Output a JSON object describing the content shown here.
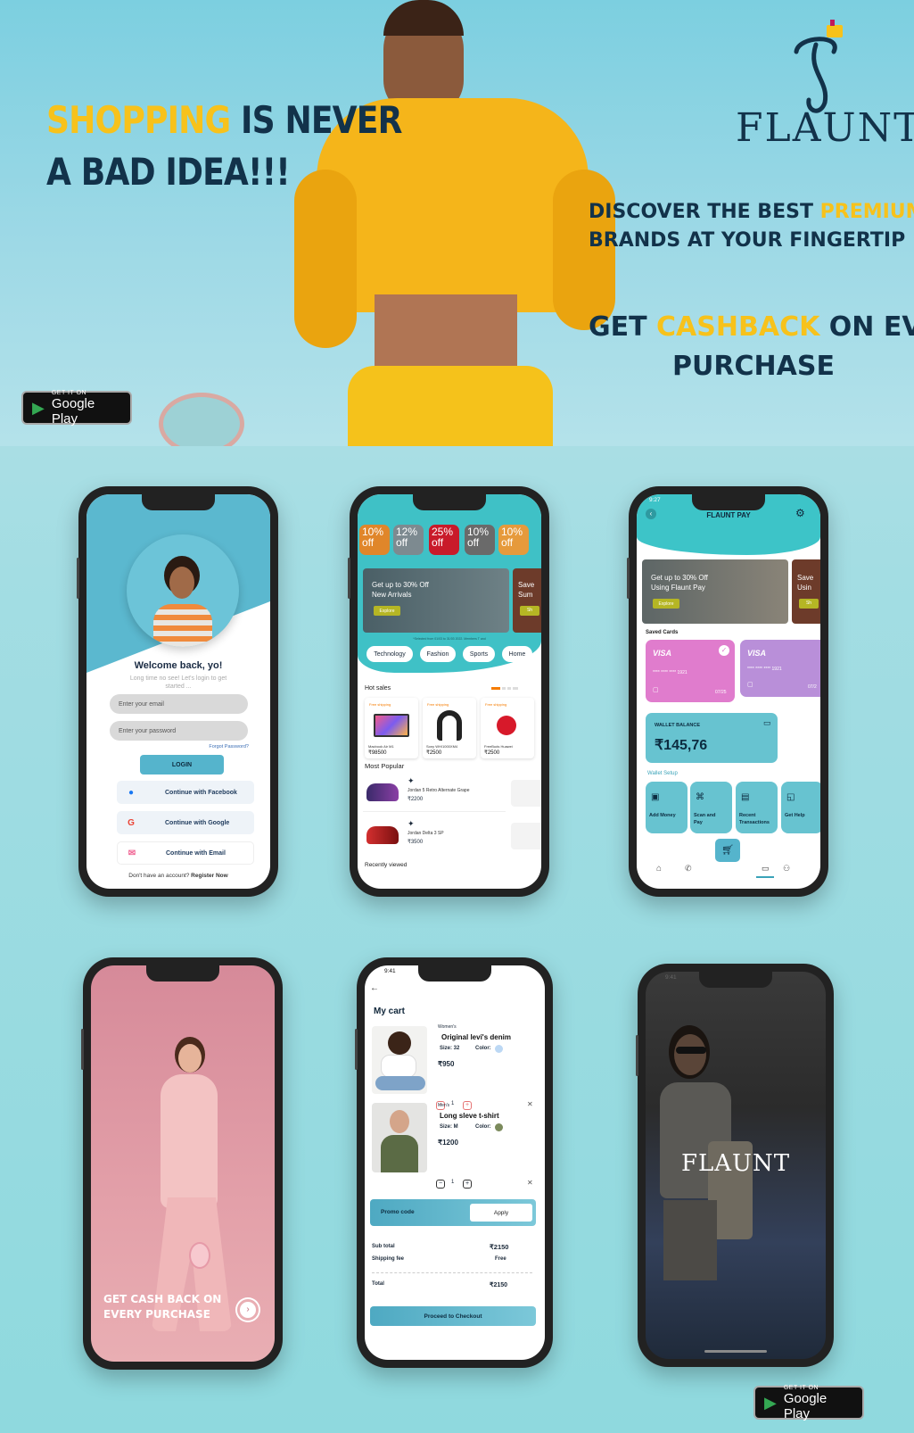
{
  "hero": {
    "headline_yellow": "SHOPPING",
    "headline_rest1": " IS NEVER",
    "headline_line2": "A BAD IDEA!!!",
    "brand": "FLAUNT",
    "tag1_pre": "DISCOVER THE BEST ",
    "tag1_yellow": "PREMIUM",
    "tag1_line2": "BRANDS AT YOUR FINGERTIP",
    "tag2_pre": "GET ",
    "tag2_yellow": "CASHBACK",
    "tag2_post": " ON EVERY",
    "tag2_line2": "PURCHASE",
    "gp_small": "GET IT ON",
    "gp_big": "Google Play"
  },
  "login": {
    "title": "Welcome back, yo!",
    "subtitle1": "Long time no see! Let's login to get",
    "subtitle2": "started ...",
    "email_placeholder": "Enter your email",
    "password_placeholder": "Enter your password",
    "forgot": "Forgot Password?",
    "login_btn": "LOGIN",
    "facebook": "Continue with Facebook",
    "google": "Continue with Google",
    "email": "Continue with Email",
    "no_account": "Don't have an account? ",
    "register": "Register Now"
  },
  "home": {
    "offers": [
      "10% off",
      "12% off",
      "25% off",
      "10% off",
      "10% off"
    ],
    "banner_title1": "Get up to 30% Off",
    "banner_title2": "New Arrivals",
    "banner_btn": "Explore",
    "banner2_a": "Save",
    "banner2_b": "Sum",
    "banner2_btn": "Sh",
    "terms": "*Selected from 01/03 to 31/03 2022. Members T and",
    "categories": [
      "Technology",
      "Fashion",
      "Sports",
      "Home"
    ],
    "hot_sales": "Hot sales",
    "products": [
      {
        "tag": "Free shipping",
        "name": "Macbook Air M1",
        "price": "₹98500"
      },
      {
        "tag": "Free shipping",
        "name": "Sony WH/1000XM4",
        "price": "₹2500"
      },
      {
        "tag": "Free shipping",
        "name": "FreeBuds Huawei",
        "price": "₹2500"
      }
    ],
    "most_popular": "Most Popular",
    "popular": [
      {
        "name": "Jordan 5 Retro Alternate Grape",
        "price": "₹2200"
      },
      {
        "name": "Jordan Delta 3 SP",
        "price": "₹3500"
      }
    ],
    "recently_viewed": "Recently viewed"
  },
  "pay": {
    "time": "9:27",
    "title": "FLAUNT PAY",
    "banner1": "Get up to 30% Off",
    "banner2": "Using Flaunt Pay",
    "banner_btn": "Explore",
    "banner_side1": "Save",
    "banner_side2": "Usin",
    "banner_side_btn": "Sh",
    "saved_cards": "Saved Cards",
    "card_brand": "VISA",
    "card_number": "**** **** **** 1921",
    "card1_exp": "07/25",
    "card2_exp": "07/2",
    "wallet_label": "WALLET BALANCE",
    "wallet_amount": "₹145,76",
    "wallet_setup": "Wallet Setup",
    "tiles": [
      "Add Money",
      "Scan and Pay",
      "Recent Transactions",
      "Get Help"
    ]
  },
  "cash": {
    "line1": "GET CASH BACK ON",
    "line2": "EVERY PURCHASE"
  },
  "cart": {
    "time": "9:41",
    "title": "My cart",
    "items": [
      {
        "category": "Women's",
        "name": "Original levi's denim",
        "size": "Size: 32",
        "color_label": "Color:",
        "price": "₹950",
        "qty": "1"
      },
      {
        "category": "Men's",
        "name": "Long sleve t-shirt",
        "size": "Size: M",
        "color_label": "Color:",
        "price": "₹1200",
        "qty": "1"
      }
    ],
    "promo": "Promo code",
    "apply": "Apply",
    "subtotal_label": "Sub total",
    "subtotal": "₹2150",
    "shipping_label": "Shipping fee",
    "shipping": "Free",
    "total_label": "Total",
    "total": "₹2150",
    "checkout": "Proceed to Checkout"
  },
  "splash": {
    "time": "9:41",
    "brand": "FLAUNT"
  },
  "colors": {
    "accent": "#4db3c8",
    "navy": "#12324a",
    "yellow": "#f7c21b",
    "card_pink": "#e07ccd",
    "card_purple": "#b98fd9"
  }
}
